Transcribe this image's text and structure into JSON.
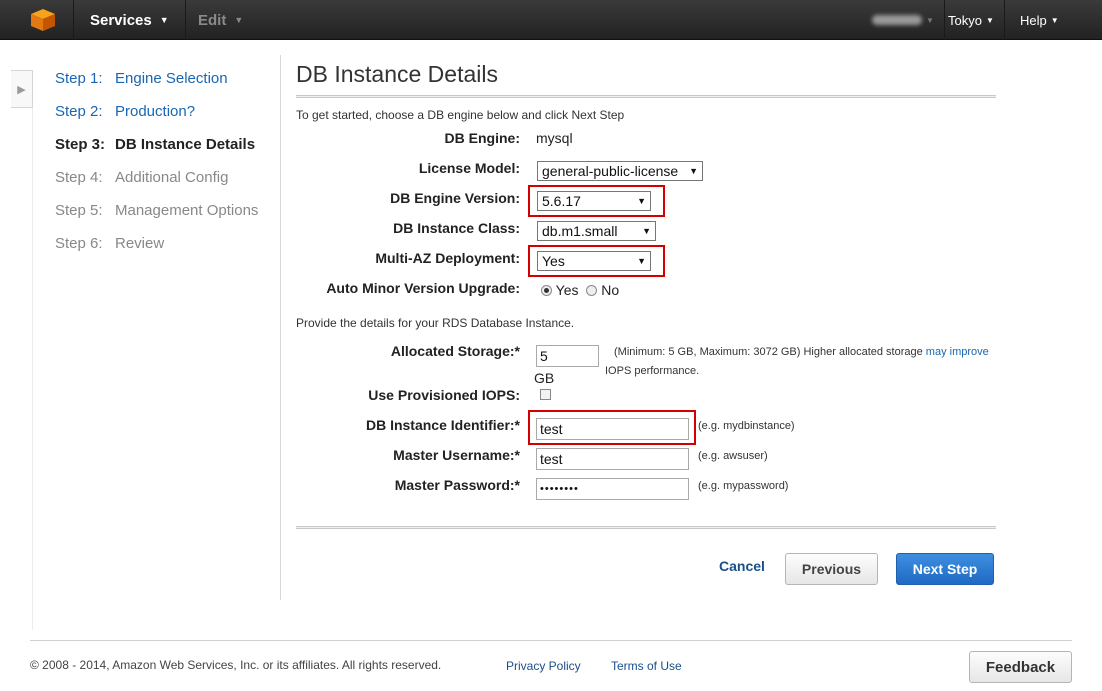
{
  "topnav": {
    "services_label": "Services",
    "edit_label": "Edit",
    "region_label": "Tokyo",
    "help_label": "Help"
  },
  "steps": [
    {
      "num": "Step 1:",
      "label": "Engine Selection",
      "state": "link"
    },
    {
      "num": "Step 2:",
      "label": "Production?",
      "state": "link"
    },
    {
      "num": "Step 3:",
      "label": "DB Instance Details",
      "state": "current"
    },
    {
      "num": "Step 4:",
      "label": "Additional Config",
      "state": "disabled"
    },
    {
      "num": "Step 5:",
      "label": "Management Options",
      "state": "disabled"
    },
    {
      "num": "Step 6:",
      "label": "Review",
      "state": "disabled"
    }
  ],
  "main": {
    "title": "DB Instance Details",
    "intro": "To get started, choose a DB engine below and click Next Step",
    "provide": "Provide the details for your RDS Database Instance."
  },
  "form": {
    "db_engine": {
      "label": "DB Engine:",
      "value": "mysql"
    },
    "license_model": {
      "label": "License Model:",
      "value": "general-public-license"
    },
    "engine_version": {
      "label": "DB Engine Version:",
      "value": "5.6.17"
    },
    "instance_class": {
      "label": "DB Instance Class:",
      "value": "db.m1.small"
    },
    "multi_az": {
      "label": "Multi-AZ Deployment:",
      "value": "Yes"
    },
    "auto_minor": {
      "label": "Auto Minor Version Upgrade:",
      "yes_label": "Yes",
      "no_label": "No",
      "selected": "Yes"
    },
    "allocated_storage": {
      "label": "Allocated Storage:*",
      "value": "5",
      "unit": "GB",
      "hint_prefix": "(Minimum: 5 GB, Maximum: 3072 GB) Higher allocated storage",
      "hint_link": "may improve",
      "hint_suffix": "IOPS performance."
    },
    "provisioned_iops": {
      "label": "Use Provisioned IOPS:",
      "checked": false
    },
    "identifier": {
      "label": "DB Instance Identifier:*",
      "value": "test",
      "hint": "(e.g. mydbinstance)"
    },
    "username": {
      "label": "Master Username:*",
      "value": "test",
      "hint": "(e.g. awsuser)"
    },
    "password": {
      "label": "Master Password:*",
      "value": "••••••••",
      "hint": "(e.g. mypassword)"
    }
  },
  "buttons": {
    "cancel": "Cancel",
    "previous": "Previous",
    "next": "Next Step"
  },
  "footer": {
    "copyright": "© 2008 - 2014, Amazon Web Services, Inc. or its affiliates. All rights reserved.",
    "privacy": "Privacy Policy",
    "terms": "Terms of Use",
    "feedback": "Feedback"
  },
  "colors": {
    "highlight": "#d40000",
    "link": "#1a66b3",
    "primary_button": "#2a78d0",
    "topnav": "#2b2b2b"
  }
}
